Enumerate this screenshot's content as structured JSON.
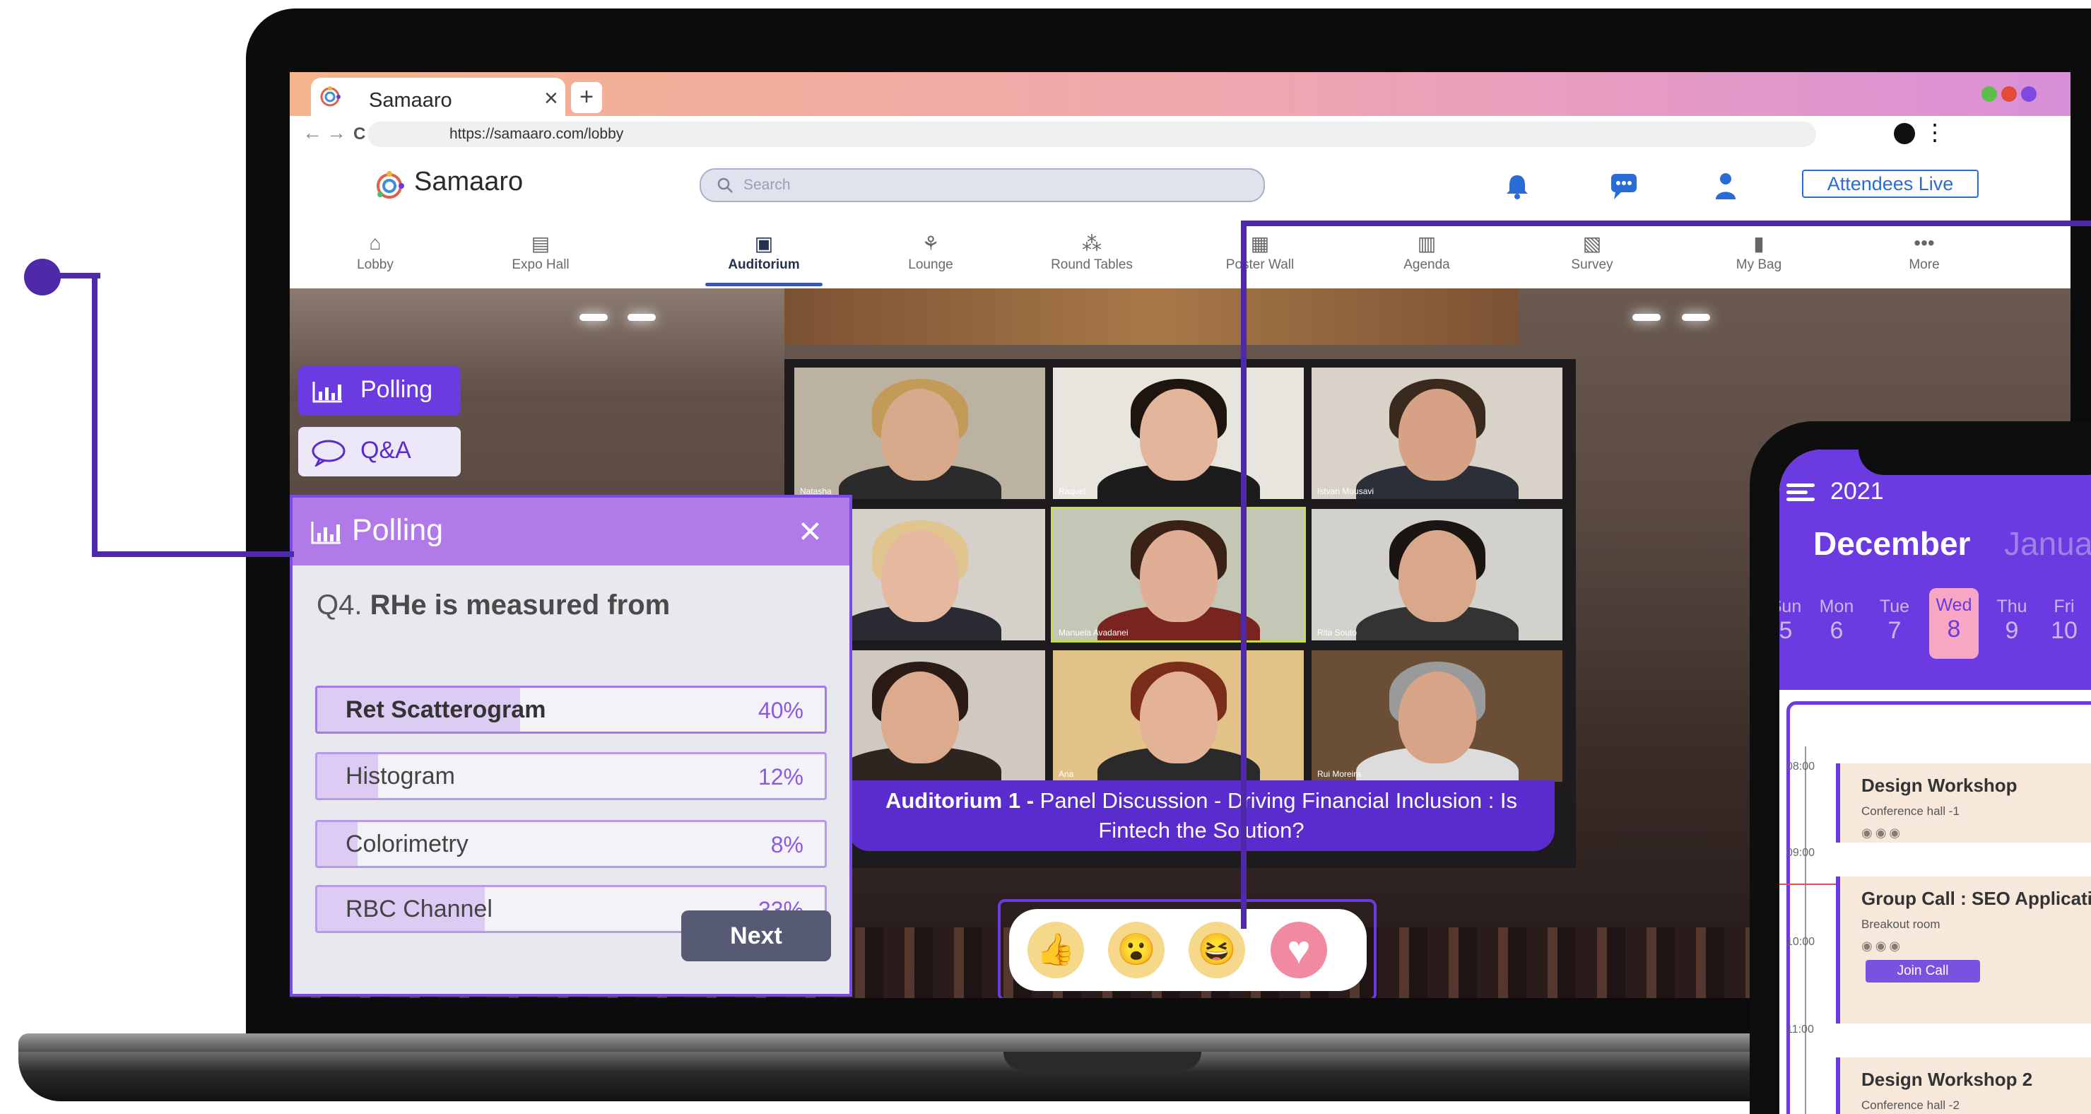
{
  "browser": {
    "tab_title": "Samaaro",
    "tab_close": "×",
    "new_tab": "+",
    "url": "https://samaaro.com/lobby",
    "back": "←",
    "forward": "→",
    "reload": "C",
    "menu": "⋮"
  },
  "header": {
    "brand": "Samaaro",
    "search_placeholder": "Search",
    "attendees_button": "Attendees Live"
  },
  "nav": {
    "items": [
      {
        "label": "Lobby",
        "icon": "⌂"
      },
      {
        "label": "Expo Hall",
        "icon": "▤"
      },
      {
        "label": "Auditorium",
        "icon": "▣"
      },
      {
        "label": "Lounge",
        "icon": "⚘"
      },
      {
        "label": "Round Tables",
        "icon": "⁂"
      },
      {
        "label": "Poster Wall",
        "icon": "▦"
      },
      {
        "label": "Agenda",
        "icon": "▥"
      },
      {
        "label": "Survey",
        "icon": "▧"
      },
      {
        "label": "My Bag",
        "icon": "▮"
      },
      {
        "label": "More",
        "icon": "•••"
      }
    ]
  },
  "side_tabs": {
    "polling": "Polling",
    "qa": "Q&A"
  },
  "video_grid": {
    "names": [
      "Natasha",
      "Raquel",
      "Istvan Mousavi",
      "",
      "Manuela Avadanei",
      "Rita Souto",
      "",
      "Ana",
      "Rui Moreira"
    ]
  },
  "caption": {
    "bold": "Auditorium 1 - ",
    "text": "Panel Discussion - Driving Financial Inclusion : Is Fintech the Solution?"
  },
  "poll": {
    "title": "Polling",
    "close": "×",
    "question_number": "Q4.",
    "question": "RHe is measured from",
    "options": [
      {
        "label": "Ret Scatterogram",
        "percent": "40%",
        "value": 40,
        "selected": true
      },
      {
        "label": "Histogram",
        "percent": "12%",
        "value": 12,
        "selected": false
      },
      {
        "label": "Colorimetry",
        "percent": "8%",
        "value": 8,
        "selected": false
      },
      {
        "label": "RBC Channel",
        "percent": "33%",
        "value": 33,
        "selected": false
      }
    ],
    "next_button": "Next"
  },
  "reactions": [
    {
      "name": "thumbs-up",
      "glyph": "👍"
    },
    {
      "name": "wow",
      "glyph": "😮"
    },
    {
      "name": "laugh",
      "glyph": "😆"
    },
    {
      "name": "love",
      "glyph": "♥"
    }
  ],
  "phone": {
    "year": "2021",
    "month": "December",
    "next_month": "Janua",
    "days": [
      {
        "name": "Sun",
        "num": "5"
      },
      {
        "name": "Mon",
        "num": "6"
      },
      {
        "name": "Tue",
        "num": "7"
      },
      {
        "name": "Wed",
        "num": "8",
        "selected": true
      },
      {
        "name": "Thu",
        "num": "9"
      },
      {
        "name": "Fri",
        "num": "10"
      }
    ],
    "times": [
      "08:00",
      "09:00",
      "10:00",
      "11:00"
    ],
    "events": [
      {
        "title": "Design  Workshop",
        "room": "Conference hall -1"
      },
      {
        "title": "Group Call : SEO Applicatio",
        "room": "Breakout room",
        "button": "Join Call"
      },
      {
        "title": "Design  Workshop 2",
        "room": "Conference hall -2"
      }
    ]
  },
  "colors": {
    "brand_purple": "#6b3ae0",
    "poll_header": "#b07ae8",
    "accent_blue": "#2a6cd6"
  }
}
